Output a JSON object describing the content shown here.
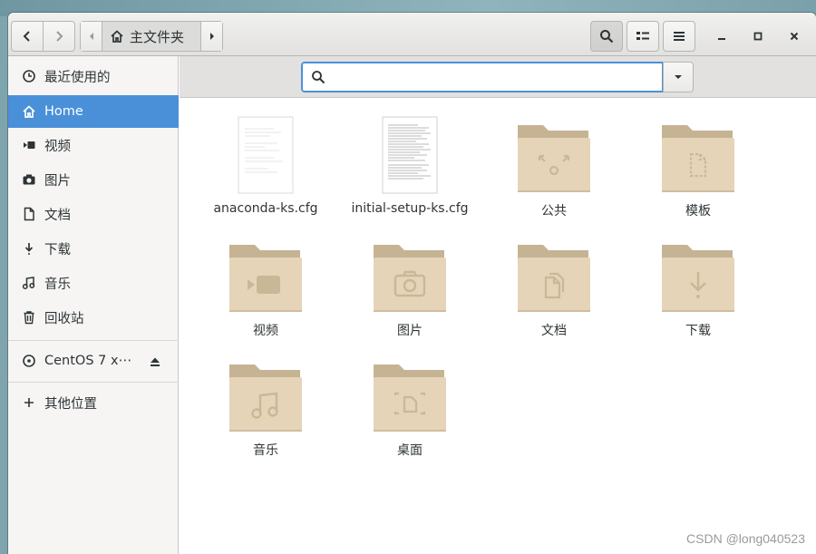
{
  "pathbar": {
    "current": "主文件夹"
  },
  "sidebar": {
    "items": [
      {
        "label": "最近使用的",
        "icon": "clock-icon"
      },
      {
        "label": "Home",
        "icon": "home-icon",
        "active": true
      },
      {
        "label": "视频",
        "icon": "video-icon"
      },
      {
        "label": "图片",
        "icon": "camera-icon"
      },
      {
        "label": "文档",
        "icon": "document-icon"
      },
      {
        "label": "下载",
        "icon": "download-icon"
      },
      {
        "label": "音乐",
        "icon": "music-icon"
      },
      {
        "label": "回收站",
        "icon": "trash-icon"
      }
    ],
    "devices": [
      {
        "label": "CentOS 7 x⋯",
        "icon": "disc-icon",
        "action_icon": "eject-icon"
      }
    ],
    "other": {
      "label": "其他位置",
      "icon": "plus-icon"
    }
  },
  "search": {
    "value": "",
    "placeholder": ""
  },
  "files": [
    {
      "name": "anaconda-ks.cfg",
      "kind": "text-file"
    },
    {
      "name": "initial-setup-ks.cfg",
      "kind": "text-file"
    },
    {
      "name": "公共",
      "kind": "folder-share"
    },
    {
      "name": "模板",
      "kind": "folder-templates"
    },
    {
      "name": "视频",
      "kind": "folder-video"
    },
    {
      "name": "图片",
      "kind": "folder-pictures"
    },
    {
      "name": "文档",
      "kind": "folder-documents"
    },
    {
      "name": "下载",
      "kind": "folder-download"
    },
    {
      "name": "音乐",
      "kind": "folder-music"
    },
    {
      "name": "桌面",
      "kind": "folder-desktop"
    }
  ],
  "colors": {
    "accent": "#4a90d9",
    "folder": "#e6d4b8",
    "folder_tab": "#c6b393"
  },
  "watermark": "CSDN @long040523"
}
